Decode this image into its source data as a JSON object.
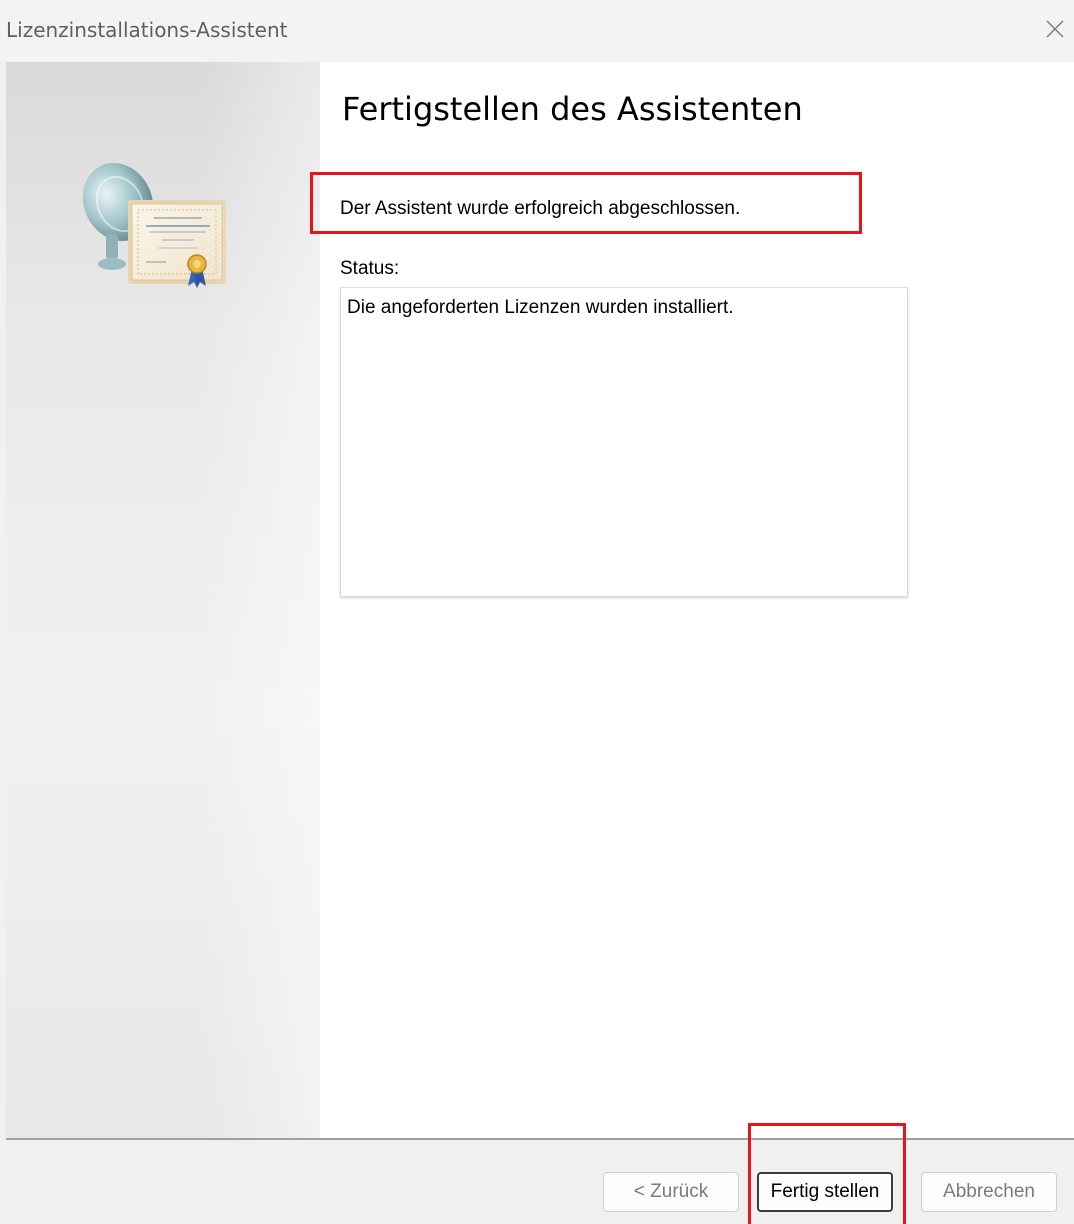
{
  "window": {
    "title": "Lizenzinstallations-Assistent"
  },
  "main": {
    "heading": "Fertigstellen des Assistenten",
    "success_message": "Der Assistent wurde erfolgreich abgeschlossen.",
    "status_label": "Status:",
    "status_text": "Die angeforderten Lizenzen wurden installiert."
  },
  "footer": {
    "back_label": "< Zurück",
    "finish_label": "Fertig stellen",
    "cancel_label": "Abbrechen"
  },
  "icons": {
    "close": "close-icon",
    "wizard_art": "license-certificate-icon"
  },
  "colors": {
    "highlight": "#e8141a",
    "content_background": "#ffffff",
    "window_background": "#f0f0f0"
  }
}
